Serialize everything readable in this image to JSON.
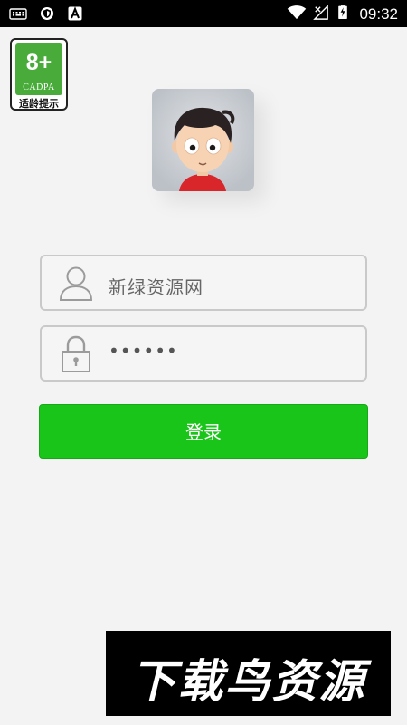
{
  "status_bar": {
    "time": "09:32",
    "icons": [
      "keyboard-icon",
      "shield-icon",
      "a-notification-icon",
      "wifi-icon",
      "no-signal-icon",
      "battery-charging-icon"
    ]
  },
  "age_badge": {
    "rating": "8+",
    "org": "CADPA",
    "tip": "适龄提示"
  },
  "login": {
    "username_value": "新绿资源网",
    "password_value": "••••••",
    "button_label": "登录"
  },
  "watermark": {
    "text": "下载鸟资源"
  },
  "colors": {
    "accent_green": "#1ac51a",
    "background": "#f3f3f3",
    "badge_green": "#49ac3a"
  }
}
